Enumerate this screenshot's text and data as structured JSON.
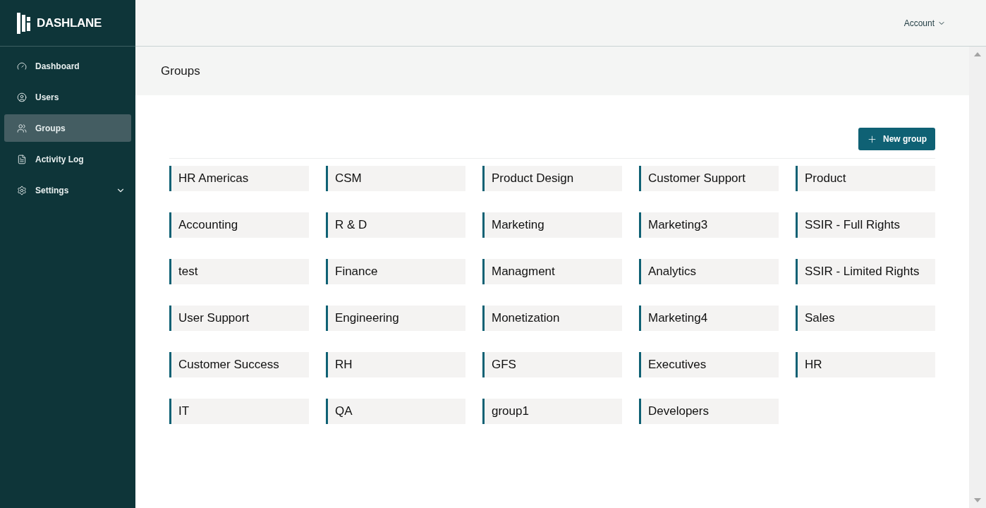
{
  "logo": {
    "text": "DASHLANE"
  },
  "sidebar": {
    "items": [
      {
        "label": "Dashboard",
        "kind": "gauge",
        "selected": false,
        "has_submenu": false
      },
      {
        "label": "Users",
        "kind": "user",
        "selected": false,
        "has_submenu": false
      },
      {
        "label": "Groups",
        "kind": "users",
        "selected": true,
        "has_submenu": false
      },
      {
        "label": "Activity Log",
        "kind": "file",
        "selected": false,
        "has_submenu": false
      },
      {
        "label": "Settings",
        "kind": "gear",
        "selected": false,
        "has_submenu": true
      }
    ]
  },
  "header": {
    "account": "Account"
  },
  "page": {
    "title": "Groups",
    "new_button": "New group"
  },
  "groups": [
    "HR Americas",
    "CSM",
    "Product Design",
    "Customer Support",
    "Product",
    "Accounting",
    "R & D",
    "Marketing",
    "Marketing3",
    "SSIR - Full Rights",
    "test",
    "Finance",
    "Managment",
    "Analytics",
    "SSIR - Limited Rights",
    "User Support",
    "Engineering",
    "Monetization",
    "Marketing4",
    "Sales",
    "Customer Success",
    "RH",
    "GFS",
    "Executives",
    "HR",
    "IT",
    "QA",
    "group1",
    "Developers"
  ]
}
